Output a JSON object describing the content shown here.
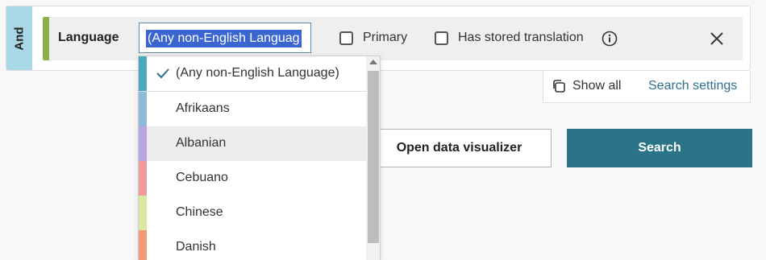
{
  "filter": {
    "group_label": "And",
    "field_label": "Language",
    "input_value": "(Any non-English Languag",
    "checkboxes": [
      {
        "label": "Primary",
        "checked": false
      },
      {
        "label": "Has stored translation",
        "checked": false
      }
    ]
  },
  "settings": {
    "show_all": "Show all",
    "search_settings": "Search settings"
  },
  "buttons": {
    "visualizer": "Open data visualizer",
    "search": "Search"
  },
  "dropdown": {
    "selected": "(Any non-English Language)",
    "items": [
      {
        "label": "(Any non-English Language)",
        "color": "#4aa8c0",
        "checked": true
      },
      {
        "label": "Afrikaans",
        "color": "#8fb9d8",
        "checked": false
      },
      {
        "label": "Albanian",
        "color": "#b7a6e0",
        "checked": false
      },
      {
        "label": "Cebuano",
        "color": "#f09a9e",
        "checked": false
      },
      {
        "label": "Chinese",
        "color": "#d8e8a0",
        "checked": false
      },
      {
        "label": "Danish",
        "color": "#f0a07a",
        "checked": false
      }
    ]
  },
  "colors": {
    "accent_green": "#8ab04a",
    "and_tab": "#a8d8e6",
    "primary_button": "#2b7488",
    "link": "#2f6f8f",
    "selection": "#3b66d1"
  }
}
